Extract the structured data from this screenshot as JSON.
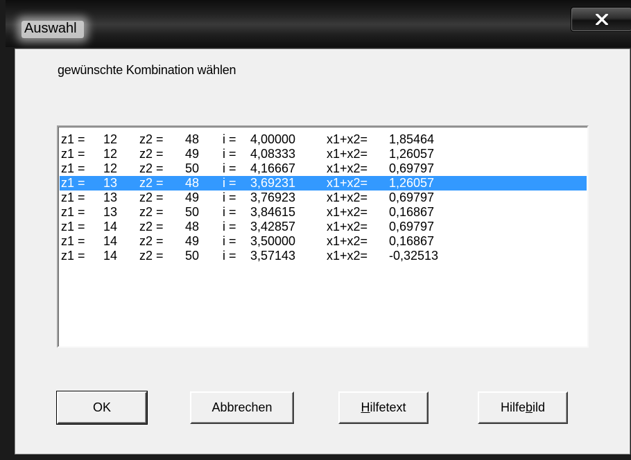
{
  "window": {
    "title": "Auswahl",
    "close_glyph": "✕"
  },
  "dialog": {
    "prompt": "gewünschte Kombination wählen"
  },
  "listbox": {
    "selected_index": 3,
    "rows": [
      {
        "z1_label": "z1 =",
        "z1": "12",
        "z2_label": "z2 =",
        "z2": "48",
        "i_label": "i =",
        "i": "4,00000",
        "x_label": "x1+x2=",
        "x": "1,85464"
      },
      {
        "z1_label": "z1 =",
        "z1": "12",
        "z2_label": "z2 =",
        "z2": "49",
        "i_label": "i =",
        "i": "4,08333",
        "x_label": "x1+x2=",
        "x": "1,26057"
      },
      {
        "z1_label": "z1 =",
        "z1": "12",
        "z2_label": "z2 =",
        "z2": "50",
        "i_label": "i =",
        "i": "4,16667",
        "x_label": "x1+x2=",
        "x": "0,69797"
      },
      {
        "z1_label": "z1 =",
        "z1": "13",
        "z2_label": "z2 =",
        "z2": "48",
        "i_label": "i =",
        "i": "3,69231",
        "x_label": "x1+x2=",
        "x": "1,26057"
      },
      {
        "z1_label": "z1 =",
        "z1": "13",
        "z2_label": "z2 =",
        "z2": "49",
        "i_label": "i =",
        "i": "3,76923",
        "x_label": "x1+x2=",
        "x": "0,69797"
      },
      {
        "z1_label": "z1 =",
        "z1": "13",
        "z2_label": "z2 =",
        "z2": "50",
        "i_label": "i =",
        "i": "3,84615",
        "x_label": "x1+x2=",
        "x": "0,16867"
      },
      {
        "z1_label": "z1 =",
        "z1": "14",
        "z2_label": "z2 =",
        "z2": "48",
        "i_label": "i =",
        "i": "3,42857",
        "x_label": "x1+x2=",
        "x": "0,69797"
      },
      {
        "z1_label": "z1 =",
        "z1": "14",
        "z2_label": "z2 =",
        "z2": "49",
        "i_label": "i =",
        "i": "3,50000",
        "x_label": "x1+x2=",
        "x": "0,16867"
      },
      {
        "z1_label": "z1 =",
        "z1": "14",
        "z2_label": "z2 =",
        "z2": "50",
        "i_label": "i =",
        "i": "3,57143",
        "x_label": "x1+x2=",
        "x": "-0,32513"
      }
    ]
  },
  "buttons": {
    "ok": "OK",
    "cancel": "Abbrechen",
    "helptext_pre": "",
    "helptext_mnemonic": "H",
    "helptext_post": "ilfetext",
    "helpimage_pre": "Hilfe",
    "helpimage_mnemonic": "b",
    "helpimage_post": "ild"
  },
  "colors": {
    "selection": "#3399ff",
    "dialog_bg": "#f0f0f0"
  }
}
